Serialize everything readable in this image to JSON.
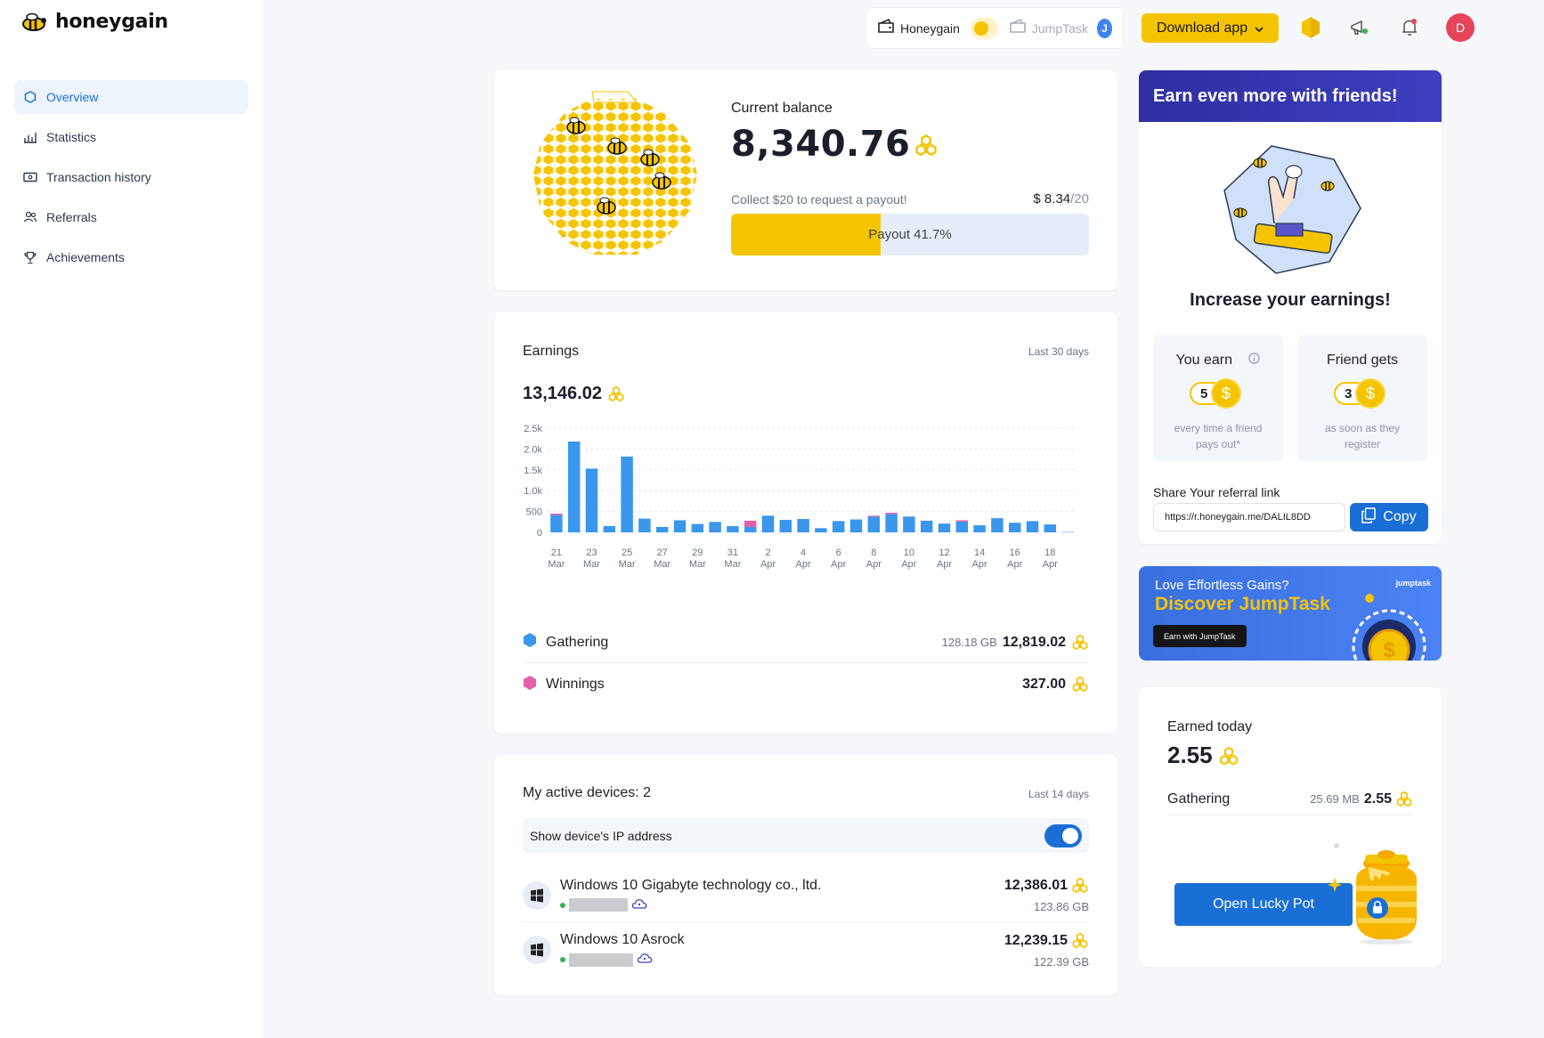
{
  "app": {
    "logo": "honeygain"
  },
  "sidebar": {
    "items": [
      {
        "label": "Overview",
        "icon": "hexagon-icon",
        "active": true
      },
      {
        "label": "Statistics",
        "icon": "bar-chart-icon"
      },
      {
        "label": "Transaction history",
        "icon": "wallet-icon"
      },
      {
        "label": "Referrals",
        "icon": "users-icon"
      },
      {
        "label": "Achievements",
        "icon": "trophy-icon"
      }
    ]
  },
  "topbar": {
    "honeygain_label": "Honeygain",
    "jumptask_label": "JumpTask",
    "jumptask_badge": "J",
    "download_label": "Download app",
    "avatar_initial": "D"
  },
  "balance": {
    "label": "Current balance",
    "value": "8,340.76",
    "payout_note": "Collect $20 to request a payout!",
    "payout_current": "$ 8.34",
    "payout_target": "/20",
    "payout_progress_text": "Payout 41.7%",
    "payout_fraction": 0.417
  },
  "earnings": {
    "title": "Earnings",
    "period": "Last 30 days",
    "total": "13,146.02",
    "legend": [
      {
        "name": "Gathering",
        "gb": "128.18 GB",
        "value": "12,819.02",
        "color": "#3a97ec"
      },
      {
        "name": "Winnings",
        "gb": "",
        "value": "327.00",
        "color": "#e55fa6"
      }
    ]
  },
  "chart_data": {
    "type": "bar",
    "stacked": true,
    "y_ticks": [
      "0",
      "500",
      "1.0k",
      "1.5k",
      "2.0k",
      "2.5k"
    ],
    "ylim": [
      0,
      2500
    ],
    "x_tick_labels": [
      [
        "21",
        "Mar"
      ],
      [
        "23",
        "Mar"
      ],
      [
        "25",
        "Mar"
      ],
      [
        "27",
        "Mar"
      ],
      [
        "29",
        "Mar"
      ],
      [
        "31",
        "Mar"
      ],
      [
        "2",
        "Apr"
      ],
      [
        "4",
        "Apr"
      ],
      [
        "6",
        "Apr"
      ],
      [
        "8",
        "Apr"
      ],
      [
        "10",
        "Apr"
      ],
      [
        "12",
        "Apr"
      ],
      [
        "14",
        "Apr"
      ],
      [
        "16",
        "Apr"
      ],
      [
        "18",
        "Apr"
      ]
    ],
    "categories": [
      "21 Mar",
      "22 Mar",
      "23 Mar",
      "24 Mar",
      "25 Mar",
      "26 Mar",
      "27 Mar",
      "28 Mar",
      "29 Mar",
      "30 Mar",
      "31 Mar",
      "1 Apr",
      "2 Apr",
      "3 Apr",
      "4 Apr",
      "5 Apr",
      "6 Apr",
      "7 Apr",
      "8 Apr",
      "9 Apr",
      "10 Apr",
      "11 Apr",
      "12 Apr",
      "13 Apr",
      "14 Apr",
      "15 Apr",
      "16 Apr",
      "17 Apr",
      "18 Apr",
      "19 Apr"
    ],
    "series": [
      {
        "name": "Gathering",
        "color": "#3a97ec",
        "values": [
          420,
          2180,
          1530,
          150,
          1820,
          330,
          130,
          290,
          200,
          250,
          150,
          130,
          400,
          300,
          320,
          100,
          270,
          310,
          380,
          440,
          380,
          280,
          210,
          260,
          170,
          340,
          230,
          270,
          190,
          10
        ]
      },
      {
        "name": "Winnings",
        "color": "#e55fa6",
        "values": [
          30,
          0,
          0,
          0,
          0,
          0,
          0,
          0,
          0,
          0,
          0,
          150,
          0,
          0,
          0,
          0,
          0,
          0,
          20,
          30,
          0,
          0,
          0,
          30,
          0,
          0,
          0,
          0,
          0,
          0
        ]
      }
    ],
    "grid": true
  },
  "devices": {
    "title": "My active devices: 2",
    "period": "Last 14 days",
    "ip_label": "Show device's IP address",
    "list": [
      {
        "name": "Windows 10 Gigabyte technology co., ltd.",
        "value": "12,386.01",
        "gb": "123.86 GB"
      },
      {
        "name": "Windows 10 Asrock",
        "value": "12,239.15",
        "gb": "122.39 GB"
      }
    ]
  },
  "referral": {
    "header": "Earn even more with friends!",
    "title": "Increase your earnings!",
    "you_earn_label": "You earn",
    "you_earn_amount": "5",
    "you_earn_desc": "every time a friend pays out*",
    "friend_label": "Friend gets",
    "friend_amount": "3",
    "friend_desc": "as soon as they register",
    "coin_symbol": "$",
    "share_label": "Share Your referral link",
    "link": "https://r.honeygain.me/DALIL8DD",
    "copy_label": "Copy"
  },
  "promo": {
    "line1": "Love Effortless Gains?",
    "line2": "Discover JumpTask",
    "button": "Earn with JumpTask",
    "brand": "jumptask"
  },
  "today": {
    "label": "Earned today",
    "value": "2.55",
    "row_label": "Gathering",
    "row_mb": "25.69 MB",
    "row_value": "2.55",
    "lucky_label": "Open Lucky Pot"
  }
}
